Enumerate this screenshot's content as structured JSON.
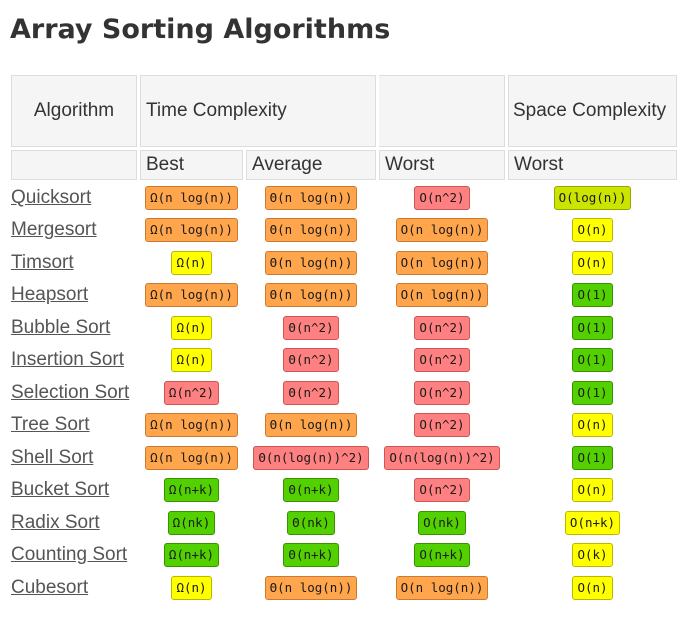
{
  "page_title": "Array Sorting Algorithms",
  "headers": {
    "algorithm": "Algorithm",
    "time_complexity": "Time Complexity",
    "space_complexity": "Space Complexity",
    "best": "Best",
    "average": "Average",
    "worst": "Worst",
    "space_worst": "Worst"
  },
  "colors": {
    "orange": "#ffa64d",
    "red": "#ff8080",
    "yellow": "#ffff00",
    "green": "#53d000",
    "lime": "#cbe500"
  },
  "rows": [
    {
      "name": "Quicksort",
      "best": {
        "text": "Ω(n log(n))",
        "color": "orange"
      },
      "average": {
        "text": "Θ(n log(n))",
        "color": "orange"
      },
      "worst": {
        "text": "O(n^2)",
        "color": "red"
      },
      "space": {
        "text": "O(log(n))",
        "color": "lime"
      }
    },
    {
      "name": "Mergesort",
      "best": {
        "text": "Ω(n log(n))",
        "color": "orange"
      },
      "average": {
        "text": "Θ(n log(n))",
        "color": "orange"
      },
      "worst": {
        "text": "O(n log(n))",
        "color": "orange"
      },
      "space": {
        "text": "O(n)",
        "color": "yellow"
      }
    },
    {
      "name": "Timsort",
      "best": {
        "text": "Ω(n)",
        "color": "yellow"
      },
      "average": {
        "text": "Θ(n log(n))",
        "color": "orange"
      },
      "worst": {
        "text": "O(n log(n))",
        "color": "orange"
      },
      "space": {
        "text": "O(n)",
        "color": "yellow"
      }
    },
    {
      "name": "Heapsort",
      "best": {
        "text": "Ω(n log(n))",
        "color": "orange"
      },
      "average": {
        "text": "Θ(n log(n))",
        "color": "orange"
      },
      "worst": {
        "text": "O(n log(n))",
        "color": "orange"
      },
      "space": {
        "text": "O(1)",
        "color": "green"
      }
    },
    {
      "name": "Bubble Sort",
      "best": {
        "text": "Ω(n)",
        "color": "yellow"
      },
      "average": {
        "text": "Θ(n^2)",
        "color": "red"
      },
      "worst": {
        "text": "O(n^2)",
        "color": "red"
      },
      "space": {
        "text": "O(1)",
        "color": "green"
      }
    },
    {
      "name": "Insertion Sort",
      "best": {
        "text": "Ω(n)",
        "color": "yellow"
      },
      "average": {
        "text": "Θ(n^2)",
        "color": "red"
      },
      "worst": {
        "text": "O(n^2)",
        "color": "red"
      },
      "space": {
        "text": "O(1)",
        "color": "green"
      }
    },
    {
      "name": "Selection Sort",
      "best": {
        "text": "Ω(n^2)",
        "color": "red"
      },
      "average": {
        "text": "Θ(n^2)",
        "color": "red"
      },
      "worst": {
        "text": "O(n^2)",
        "color": "red"
      },
      "space": {
        "text": "O(1)",
        "color": "green"
      }
    },
    {
      "name": "Tree Sort",
      "best": {
        "text": "Ω(n log(n))",
        "color": "orange"
      },
      "average": {
        "text": "Θ(n log(n))",
        "color": "orange"
      },
      "worst": {
        "text": "O(n^2)",
        "color": "red"
      },
      "space": {
        "text": "O(n)",
        "color": "yellow"
      }
    },
    {
      "name": "Shell Sort",
      "best": {
        "text": "Ω(n log(n))",
        "color": "orange"
      },
      "average": {
        "text": "Θ(n(log(n))^2)",
        "color": "red"
      },
      "worst": {
        "text": "O(n(log(n))^2)",
        "color": "red"
      },
      "space": {
        "text": "O(1)",
        "color": "green"
      }
    },
    {
      "name": "Bucket Sort",
      "best": {
        "text": "Ω(n+k)",
        "color": "green"
      },
      "average": {
        "text": "Θ(n+k)",
        "color": "green"
      },
      "worst": {
        "text": "O(n^2)",
        "color": "red"
      },
      "space": {
        "text": "O(n)",
        "color": "yellow"
      }
    },
    {
      "name": "Radix Sort",
      "best": {
        "text": "Ω(nk)",
        "color": "green"
      },
      "average": {
        "text": "Θ(nk)",
        "color": "green"
      },
      "worst": {
        "text": "O(nk)",
        "color": "green"
      },
      "space": {
        "text": "O(n+k)",
        "color": "yellow"
      }
    },
    {
      "name": "Counting Sort",
      "best": {
        "text": "Ω(n+k)",
        "color": "green"
      },
      "average": {
        "text": "Θ(n+k)",
        "color": "green"
      },
      "worst": {
        "text": "O(n+k)",
        "color": "green"
      },
      "space": {
        "text": "O(k)",
        "color": "yellow"
      }
    },
    {
      "name": "Cubesort",
      "best": {
        "text": "Ω(n)",
        "color": "yellow"
      },
      "average": {
        "text": "Θ(n log(n))",
        "color": "orange"
      },
      "worst": {
        "text": "O(n log(n))",
        "color": "orange"
      },
      "space": {
        "text": "O(n)",
        "color": "yellow"
      }
    }
  ]
}
